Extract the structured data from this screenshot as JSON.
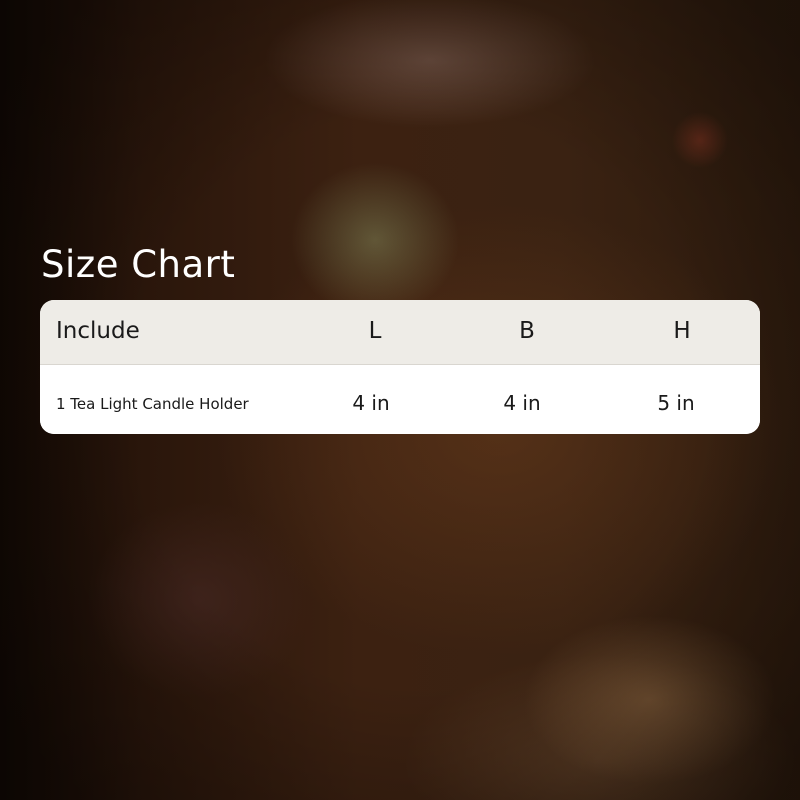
{
  "title": "Size Chart",
  "table": {
    "headers": [
      "Include",
      "L",
      "B",
      "H"
    ],
    "rows": [
      [
        "1 Tea Light Candle Holder",
        "4 in",
        "4 in",
        "5 in"
      ]
    ]
  }
}
